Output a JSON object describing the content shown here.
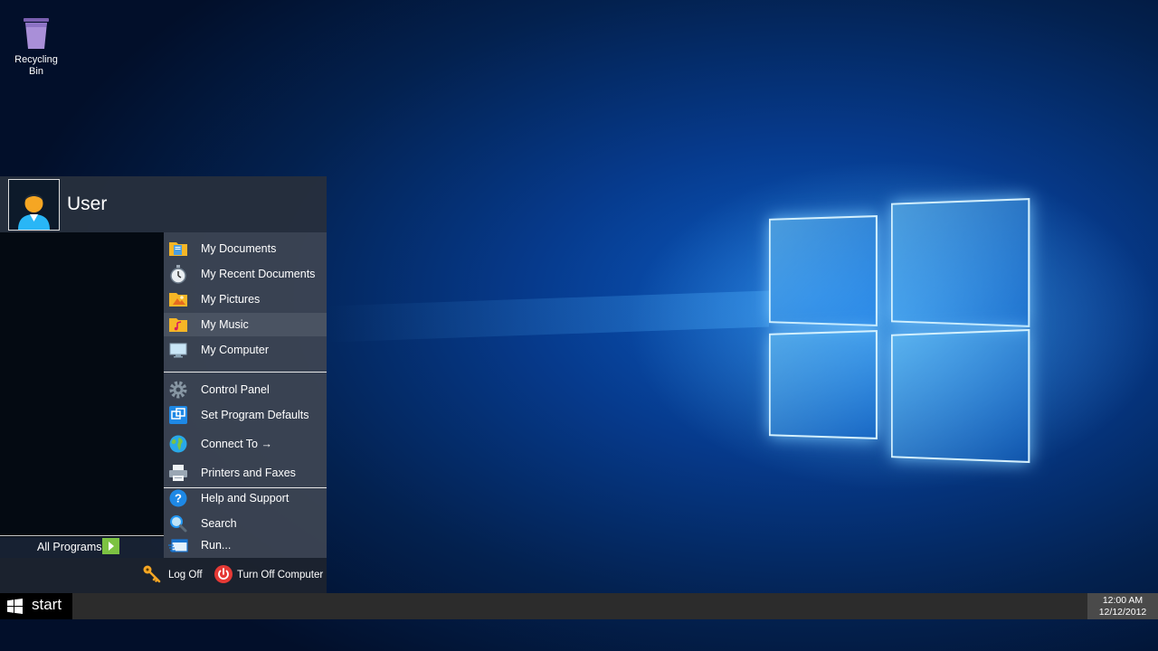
{
  "desktop": {
    "icons": [
      {
        "label": "Recycling Bin",
        "icon": "recycle-bin-icon"
      }
    ]
  },
  "start_menu": {
    "user": {
      "name": "User",
      "icon": "user-avatar-icon"
    },
    "items": [
      {
        "label": "My Documents",
        "icon": "documents-folder-icon"
      },
      {
        "label": "My Recent Documents",
        "icon": "stopwatch-icon"
      },
      {
        "label": "My Pictures",
        "icon": "pictures-folder-icon"
      },
      {
        "label": "My Music",
        "icon": "music-folder-icon"
      },
      {
        "label": "My Computer",
        "icon": "monitor-icon"
      },
      {
        "label": "Control Panel",
        "icon": "gear-icon"
      },
      {
        "label": "Set Program Defaults",
        "icon": "program-defaults-icon"
      },
      {
        "label": "Connect To →",
        "icon": "globe-icon"
      },
      {
        "label": "Printers and Faxes",
        "icon": "printer-icon"
      },
      {
        "label": "Help and Support",
        "icon": "help-icon"
      },
      {
        "label": "Search",
        "icon": "search-icon"
      },
      {
        "label": "Run...",
        "icon": "run-icon"
      }
    ],
    "all_programs": {
      "label": "All Programs",
      "icon": "play-arrow-icon"
    },
    "footer": {
      "log_off": {
        "label": "Log Off",
        "icon": "key-icon"
      },
      "turn_off": {
        "label": "Turn Off Computer",
        "icon": "power-icon"
      }
    }
  },
  "taskbar": {
    "start_label": "start",
    "start_icon": "windows-logo-icon",
    "clock": {
      "time": "12:00 AM",
      "date": "12/12/2012"
    }
  },
  "colors": {
    "desktop_blue": "#0b5bc4",
    "taskbar": "#2c2c2c",
    "all_programs_arrow": "#7cc242",
    "power_red": "#e53935"
  }
}
